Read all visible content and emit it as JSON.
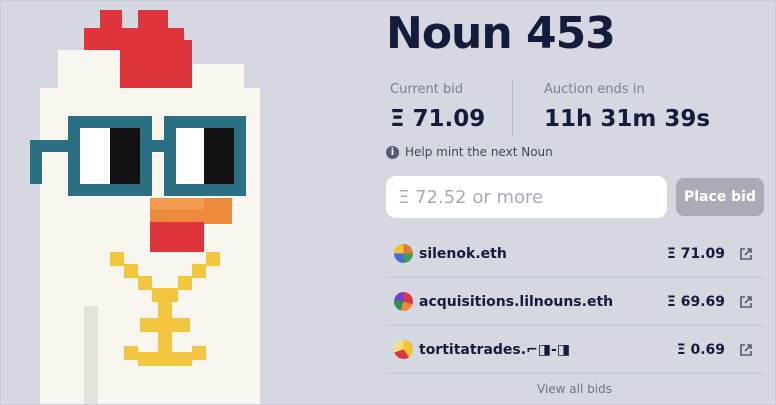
{
  "noun": {
    "title": "Noun 453"
  },
  "auction": {
    "current_bid_label": "Current bid",
    "current_bid_value": "Ξ 71.09",
    "ends_label": "Auction ends in",
    "ends_value": "11h 31m 39s",
    "help_text": "Help mint the next Noun"
  },
  "bid_form": {
    "placeholder": "Ξ 72.52 or more",
    "button_label": "Place bid"
  },
  "bids": [
    {
      "bidder": "silenok.eth",
      "amount": "Ξ 71.09",
      "avatar_color": "#e07a3a"
    },
    {
      "bidder": "acquisitions.lilnouns.eth",
      "amount": "Ξ 69.69",
      "avatar_color": "#d63a4a"
    },
    {
      "bidder": "tortitatrades.⌐◨-◨",
      "amount": "Ξ 0.69",
      "avatar_color": "#f2c231"
    }
  ],
  "view_all_label": "View all bids",
  "icons": {
    "info": "info-icon",
    "external": "external-link-icon"
  },
  "colors": {
    "background": "#d5d7e1",
    "title": "#151c3b",
    "button": "#a9acb6"
  }
}
